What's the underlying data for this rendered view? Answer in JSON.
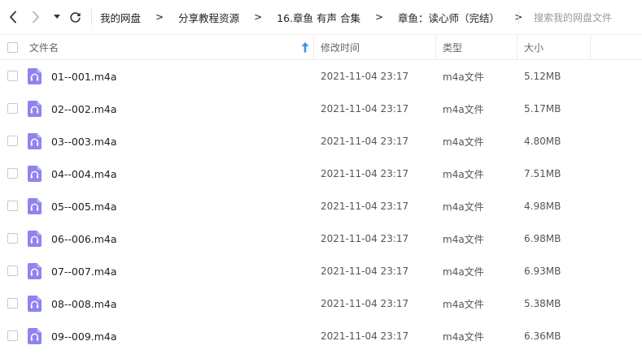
{
  "toolbar": {
    "back_icon": "chevron-left-icon",
    "forward_icon": "chevron-right-icon",
    "history_icon": "caret-down-icon",
    "refresh_icon": "refresh-icon"
  },
  "breadcrumb": {
    "items": [
      "我的网盘",
      "分享教程资源",
      "16.章鱼 有声 合集",
      "章鱼：读心师（完结）"
    ],
    "separator": ">"
  },
  "search": {
    "placeholder": "搜索我的网盘文件"
  },
  "columns": {
    "name": "文件名",
    "modified": "修改时间",
    "type": "类型",
    "size": "大小"
  },
  "colors": {
    "icon_purple": "#8e84f0",
    "sort_arrow_blue": "#3b8ff0",
    "header_text": "#666666"
  },
  "files": [
    {
      "name": "01--001.m4a",
      "modified": "2021-11-04 23:17",
      "type": "m4a文件",
      "size": "5.12MB",
      "icon": "audio-file-icon"
    },
    {
      "name": "02--002.m4a",
      "modified": "2021-11-04 23:17",
      "type": "m4a文件",
      "size": "5.17MB",
      "icon": "audio-file-icon"
    },
    {
      "name": "03--003.m4a",
      "modified": "2021-11-04 23:17",
      "type": "m4a文件",
      "size": "4.80MB",
      "icon": "audio-file-icon"
    },
    {
      "name": "04--004.m4a",
      "modified": "2021-11-04 23:17",
      "type": "m4a文件",
      "size": "7.51MB",
      "icon": "audio-file-icon"
    },
    {
      "name": "05--005.m4a",
      "modified": "2021-11-04 23:17",
      "type": "m4a文件",
      "size": "4.98MB",
      "icon": "audio-file-icon"
    },
    {
      "name": "06--006.m4a",
      "modified": "2021-11-04 23:17",
      "type": "m4a文件",
      "size": "6.98MB",
      "icon": "audio-file-icon"
    },
    {
      "name": "07--007.m4a",
      "modified": "2021-11-04 23:17",
      "type": "m4a文件",
      "size": "6.93MB",
      "icon": "audio-file-icon"
    },
    {
      "name": "08--008.m4a",
      "modified": "2021-11-04 23:17",
      "type": "m4a文件",
      "size": "5.38MB",
      "icon": "audio-file-icon"
    },
    {
      "name": "09--009.m4a",
      "modified": "2021-11-04 23:17",
      "type": "m4a文件",
      "size": "6.36MB",
      "icon": "audio-file-icon"
    }
  ]
}
